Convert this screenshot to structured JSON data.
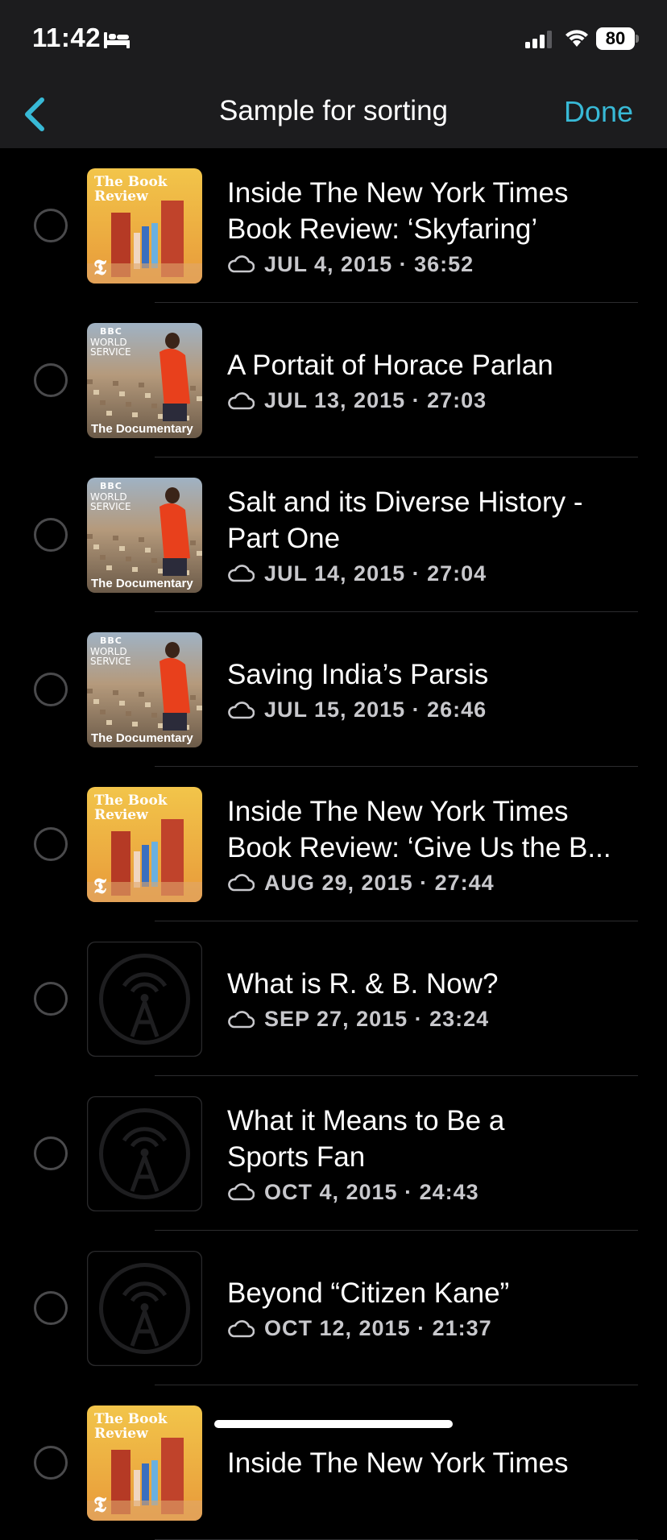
{
  "status": {
    "time": "11:42",
    "battery_level": "80"
  },
  "nav": {
    "title": "Sample for sorting",
    "done_label": "Done",
    "accent_color": "#38b9d6"
  },
  "episodes": [
    {
      "title": "Inside The New York Times\nBook Review: ‘Skyfaring’",
      "date": "JUL 4, 2015",
      "duration": "36:52",
      "artwork": "book-review",
      "art_title": "The Book\nReview"
    },
    {
      "title": "A Portait of Horace Parlan",
      "date": "JUL 13, 2015",
      "duration": "27:03",
      "artwork": "bbc-documentary",
      "art_brand": "BBC",
      "art_line1": "WORLD",
      "art_line2": "SERVICE",
      "art_caption": "The Documentary"
    },
    {
      "title": "Salt and its Diverse History -\nPart One",
      "date": "JUL 14, 2015",
      "duration": "27:04",
      "artwork": "bbc-documentary",
      "art_brand": "BBC",
      "art_line1": "WORLD",
      "art_line2": "SERVICE",
      "art_caption": "The Documentary"
    },
    {
      "title": "Saving India’s Parsis",
      "date": "JUL 15, 2015",
      "duration": "26:46",
      "artwork": "bbc-documentary",
      "art_brand": "BBC",
      "art_line1": "WORLD",
      "art_line2": "SERVICE",
      "art_caption": "The Documentary"
    },
    {
      "title": "Inside The New York Times\nBook Review: ‘Give Us the B...",
      "date": "AUG 29, 2015",
      "duration": "27:44",
      "artwork": "book-review",
      "art_title": "The Book\nReview"
    },
    {
      "title": "What is R. & B. Now?",
      "date": "SEP 27, 2015",
      "duration": "23:24",
      "artwork": "placeholder-podcast"
    },
    {
      "title": "What it Means to Be a\nSports Fan",
      "date": "OCT 4, 2015",
      "duration": "24:43",
      "artwork": "placeholder-podcast"
    },
    {
      "title": "Beyond “Citizen Kane”",
      "date": "OCT 12, 2015",
      "duration": "21:37",
      "artwork": "placeholder-podcast"
    },
    {
      "title": "Inside The New York Times",
      "date": "",
      "duration": "",
      "artwork": "book-review",
      "art_title": "The Book\nReview"
    }
  ]
}
